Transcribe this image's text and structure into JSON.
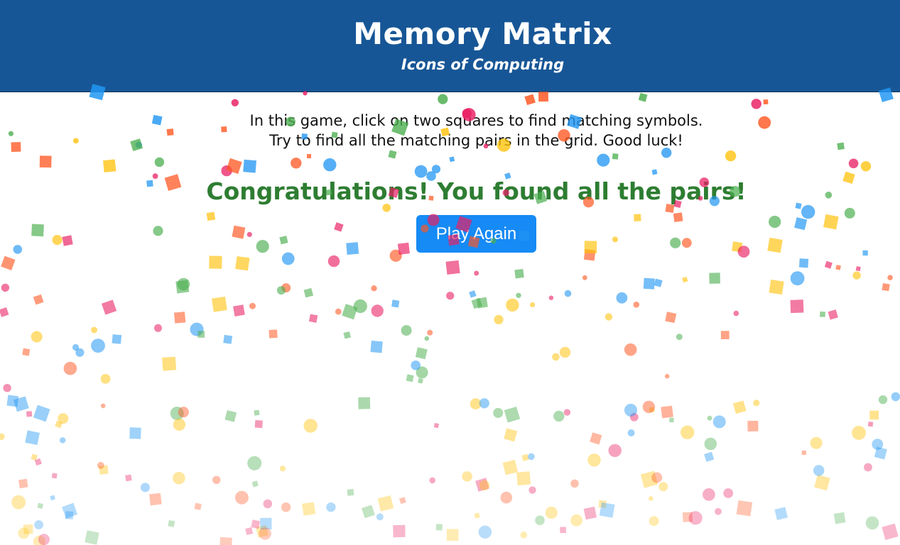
{
  "header": {
    "title": "Memory Matrix",
    "subtitle": "Icons of Computing"
  },
  "game": {
    "instructions_line1": "In this game, click on two squares to find matching symbols.",
    "instructions_line2": "Try to find all the matching pairs in the grid. Good luck!",
    "congrats_message": "Congratulations! You found all the pairs!",
    "play_again_label": "Play Again"
  },
  "colors": {
    "header_bg": "#175696",
    "congrats_text": "#2e7d32",
    "button_bg": "#168af5",
    "confetti": [
      "#e91e63",
      "#2196f3",
      "#4caf50",
      "#ffc107",
      "#ff5722"
    ]
  }
}
